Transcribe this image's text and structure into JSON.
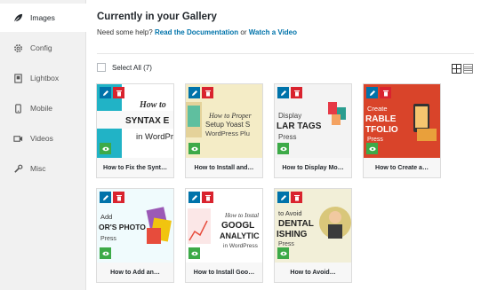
{
  "sidebar": {
    "items": [
      {
        "label": "Images",
        "icon": "leaf-icon",
        "active": true
      },
      {
        "label": "Config",
        "icon": "gear-icon"
      },
      {
        "label": "Lightbox",
        "icon": "lightbox-icon"
      },
      {
        "label": "Mobile",
        "icon": "mobile-icon"
      },
      {
        "label": "Videos",
        "icon": "video-icon"
      },
      {
        "label": "Misc",
        "icon": "wrench-icon"
      }
    ]
  },
  "header": {
    "title": "Currently in your Gallery",
    "help_prefix": "Need some help?",
    "doc_link": "Read the Documentation",
    "or_text": "or",
    "video_link": "Watch a Video"
  },
  "toolbar": {
    "select_all": "Select All (7)",
    "view_grid_icon": "grid-view-icon",
    "view_list_icon": "list-view-icon"
  },
  "images": [
    {
      "caption": "How to Fix the Synt…",
      "thumb_text": [
        "How to",
        "SYNTAX E",
        "in WordPr"
      ],
      "colors": {
        "accent": "#21b3c6"
      }
    },
    {
      "caption": "How to Install and…",
      "thumb_text": [
        "How to Proper",
        "Setup Yoast S",
        "WordPress Plu"
      ],
      "colors": {
        "accent": "#f4ecc6"
      }
    },
    {
      "caption": "How to Display Mo…",
      "thumb_text": [
        "Display",
        "LAR TAGS",
        "Press"
      ],
      "colors": {
        "accent": "#e8e8e8"
      }
    },
    {
      "caption": "How to Create a…",
      "thumb_text": [
        "Create",
        "RABLE",
        "TFOLIO",
        "Press"
      ],
      "colors": {
        "accent": "#d9442a"
      }
    },
    {
      "caption": "How to Add an…",
      "thumb_text": [
        "Add",
        "OR'S PHOTO",
        "Press"
      ],
      "colors": {
        "accent": "#3bbccd"
      }
    },
    {
      "caption": "How to Install Goo…",
      "thumb_text": [
        "How to Instal",
        "GOOGL",
        "ANALYTIC",
        "in WordPress"
      ],
      "colors": {
        "accent": "#ffffff"
      }
    },
    {
      "caption": "How to Avoid…",
      "thumb_text": [
        "to Avoid",
        "DENTAL",
        "ISHING",
        "Press"
      ],
      "colors": {
        "accent": "#f2efd8"
      }
    }
  ]
}
